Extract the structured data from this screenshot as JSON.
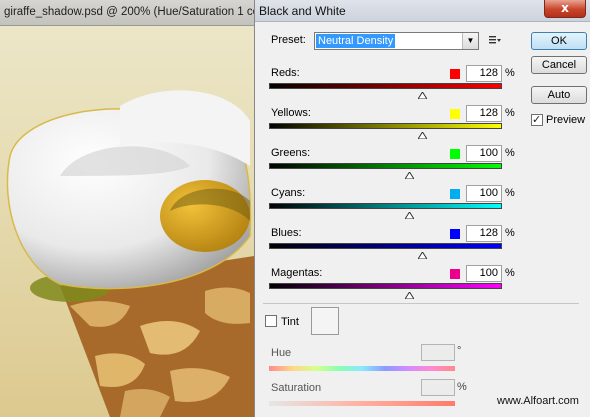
{
  "document": {
    "title": "giraffe_shadow.psd @ 200% (Hue/Saturation 1 copy 2, RGB/8)"
  },
  "dialog": {
    "title": "Black and White",
    "close_label": "x",
    "preset": {
      "label": "Preset:",
      "value": "Neutral Density"
    },
    "buttons": {
      "ok": "OK",
      "cancel": "Cancel",
      "auto": "Auto"
    },
    "preview": {
      "label": "Preview",
      "checked": true
    },
    "sliders": [
      {
        "label": "Reds:",
        "value": "128",
        "unit": "%",
        "color": "#ff0000",
        "gradient_start": "#000000",
        "gradient_end": "#ff0000",
        "level": 128
      },
      {
        "label": "Yellows:",
        "value": "128",
        "unit": "%",
        "color": "#ffff00",
        "gradient_start": "#000000",
        "gradient_end": "#ffff00",
        "level": 128
      },
      {
        "label": "Greens:",
        "value": "100",
        "unit": "%",
        "color": "#00ff00",
        "gradient_start": "#000000",
        "gradient_end": "#00ff00",
        "level": 100
      },
      {
        "label": "Cyans:",
        "value": "100",
        "unit": "%",
        "color": "#00aeef",
        "gradient_start": "#000000",
        "gradient_end": "#00ffff",
        "level": 100
      },
      {
        "label": "Blues:",
        "value": "128",
        "unit": "%",
        "color": "#0000ff",
        "gradient_start": "#000000",
        "gradient_end": "#0000ff",
        "level": 128
      },
      {
        "label": "Magentas:",
        "value": "100",
        "unit": "%",
        "color": "#ec008c",
        "gradient_start": "#000000",
        "gradient_end": "#ff00ff",
        "level": 100
      }
    ],
    "tint": {
      "label": "Tint",
      "checked": false
    },
    "hue": {
      "label": "Hue",
      "value": "",
      "unit": "°"
    },
    "saturation": {
      "label": "Saturation",
      "value": "",
      "unit": "%"
    }
  },
  "watermark": "www.Alfoart.com"
}
